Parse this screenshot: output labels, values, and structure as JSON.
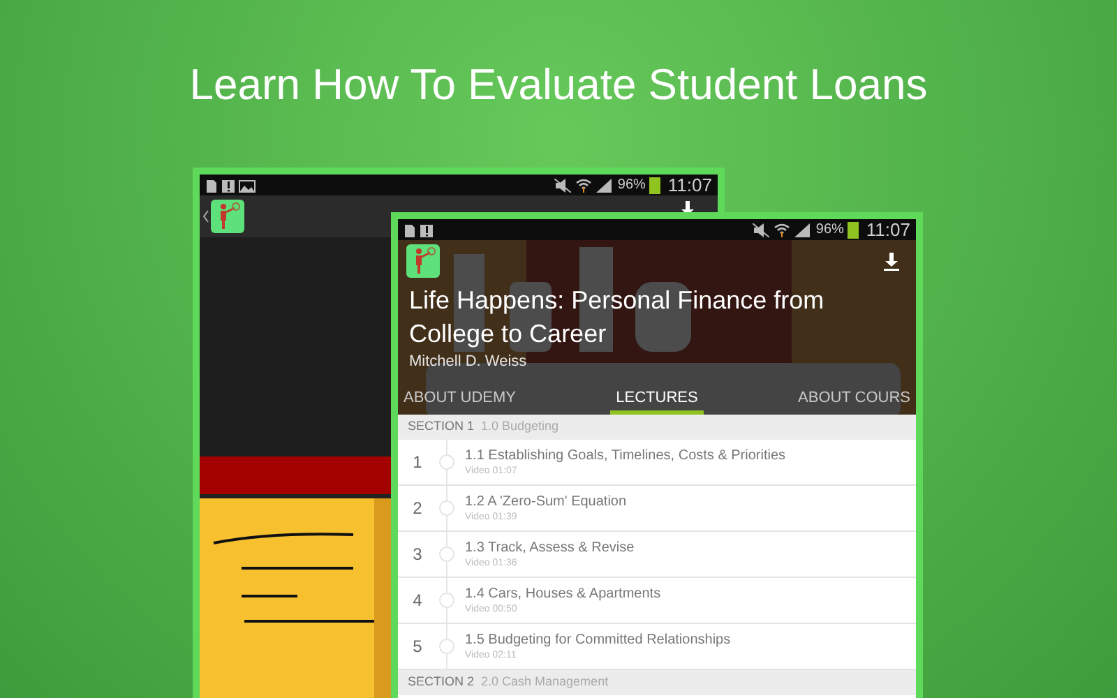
{
  "headline": "Learn How To Evaluate Student Loans",
  "back_screen": {
    "status_bar": {
      "battery": "96%",
      "time": "11:07"
    }
  },
  "front_screen": {
    "status_bar": {
      "battery": "96%",
      "time": "11:07"
    },
    "course": {
      "title": "Life Happens: Personal Finance from College to Career",
      "author": "Mitchell D. Weiss"
    },
    "tabs": [
      {
        "label": "ABOUT UDEMY",
        "selected": false
      },
      {
        "label": "LECTURES",
        "selected": true
      },
      {
        "label": "ABOUT COURS",
        "selected": false
      }
    ],
    "sections": [
      {
        "label": "SECTION 1",
        "title": "1.0 Budgeting",
        "lectures": [
          {
            "number": "1",
            "title": "1.1 Establishing Goals, Timelines, Costs & Priorities",
            "meta": "Video 01:07"
          },
          {
            "number": "2",
            "title": "1.2 A 'Zero-Sum' Equation",
            "meta": "Video 01:39"
          },
          {
            "number": "3",
            "title": "1.3 Track, Assess & Revise",
            "meta": "Video 01:36"
          },
          {
            "number": "4",
            "title": "1.4 Cars, Houses & Apartments",
            "meta": "Video 00:50"
          },
          {
            "number": "5",
            "title": "1.5 Budgeting for Committed Relationships",
            "meta": "Video 02:11"
          }
        ]
      },
      {
        "label": "SECTION 2",
        "title": "2.0 Cash Management"
      }
    ]
  }
}
